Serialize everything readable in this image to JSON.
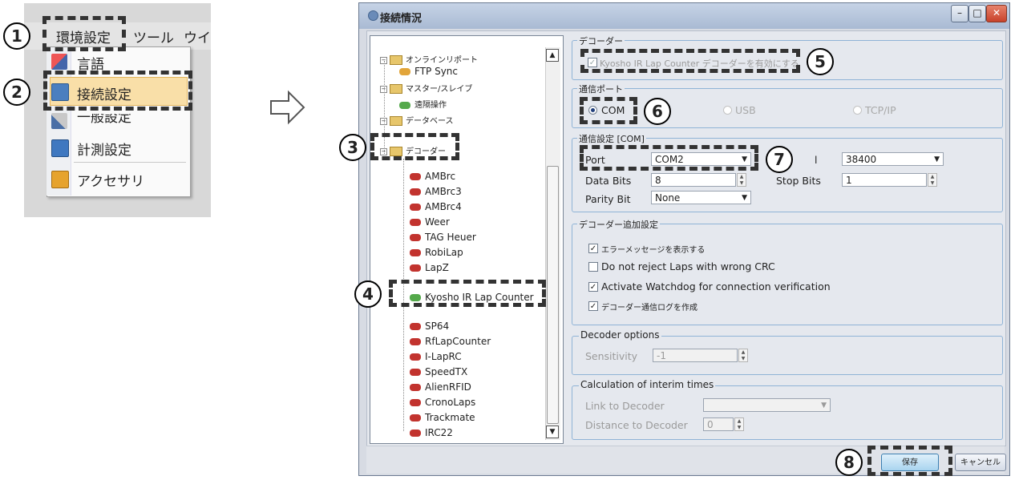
{
  "menu": {
    "bar_items": [
      "環境設定",
      "ツール",
      "ウイ"
    ],
    "dropdown_items": [
      "言語",
      "接続設定",
      "一般設定",
      "計測設定",
      "アクセサリ"
    ]
  },
  "badges": [
    "1",
    "2",
    "3",
    "4",
    "5",
    "6",
    "7",
    "8"
  ],
  "dialog": {
    "title": "接続情況",
    "window_controls": {
      "minimize": "–",
      "maximize": "□",
      "close": "✕"
    },
    "tree": [
      {
        "label": "オンラインリポート",
        "kind": "folder",
        "expanded": true,
        "level": 0
      },
      {
        "label": "FTP Sync",
        "kind": "item",
        "level": 1
      },
      {
        "label": "マスター/スレイブ",
        "kind": "folder",
        "expanded": true,
        "level": 0
      },
      {
        "label": "遠隔操作",
        "kind": "item",
        "level": 1
      },
      {
        "label": "データベース",
        "kind": "folder",
        "expanded": true,
        "level": 0
      },
      {
        "label": "デコーダー",
        "kind": "folder",
        "expanded": true,
        "level": 0
      },
      {
        "label": "AMBrc",
        "kind": "decoder",
        "level": 1
      },
      {
        "label": "AMBrc3",
        "kind": "decoder",
        "level": 1
      },
      {
        "label": "AMBrc4",
        "kind": "decoder",
        "level": 1
      },
      {
        "label": "Weer",
        "kind": "decoder",
        "level": 1
      },
      {
        "label": "TAG Heuer",
        "kind": "decoder",
        "level": 1
      },
      {
        "label": "RobiLap",
        "kind": "decoder",
        "level": 1
      },
      {
        "label": "LapZ",
        "kind": "decoder",
        "level": 1
      },
      {
        "label": "Kyosho IR Lap Counter",
        "kind": "decoder-selected",
        "level": 1
      },
      {
        "label": "SP64",
        "kind": "decoder",
        "level": 1
      },
      {
        "label": "RfLapCounter",
        "kind": "decoder",
        "level": 1
      },
      {
        "label": "I-LapRC",
        "kind": "decoder",
        "level": 1
      },
      {
        "label": "SpeedTX",
        "kind": "decoder",
        "level": 1
      },
      {
        "label": "AlienRFID",
        "kind": "decoder",
        "level": 1
      },
      {
        "label": "CronoLaps",
        "kind": "decoder",
        "level": 1
      },
      {
        "label": "Trackmate",
        "kind": "decoder",
        "level": 1
      },
      {
        "label": "IRC22",
        "kind": "decoder",
        "level": 1
      }
    ],
    "decoder_group": {
      "title": "デコーダー",
      "enable_label": "Kyosho IR Lap Counter デコーダーを有効にする",
      "enabled": true
    },
    "port_group": {
      "title": "通信ポート",
      "options": [
        "COM",
        "USB",
        "TCP/IP"
      ],
      "selected": "COM"
    },
    "com_group": {
      "title": "通信設定 [COM]",
      "port_label": "Port",
      "port_value": "COM2",
      "baud_value": "38400",
      "databits_label": "Data Bits",
      "databits_value": "8",
      "stopbits_label": "Stop Bits",
      "stopbits_value": "1",
      "parity_label": "Parity Bit",
      "parity_value": "None",
      "dropdown_arrow": "▼"
    },
    "extra_group": {
      "title": "デコーダー追加設定",
      "options": [
        {
          "label": "エラーメッセージを表示する",
          "checked": true
        },
        {
          "label": "Do not reject Laps with wrong CRC",
          "checked": false
        },
        {
          "label": "Activate Watchdog for connection verification",
          "checked": true
        },
        {
          "label": "デコーダー通信ログを作成",
          "checked": true
        }
      ]
    },
    "options_group": {
      "title": "Decoder options",
      "sensitivity_label": "Sensitivity",
      "sensitivity_value": "-1"
    },
    "interim_group": {
      "title": "Calculation of interim times",
      "link_label": "Link to Decoder",
      "link_value": "",
      "distance_label": "Distance to Decoder",
      "distance_value": "0"
    },
    "buttons": {
      "save": "保存",
      "cancel": "キャンセル"
    }
  },
  "colors": {
    "highlight": "#f9dfa8",
    "dashed": "#333333",
    "title_gradient": "#a9bad3"
  }
}
